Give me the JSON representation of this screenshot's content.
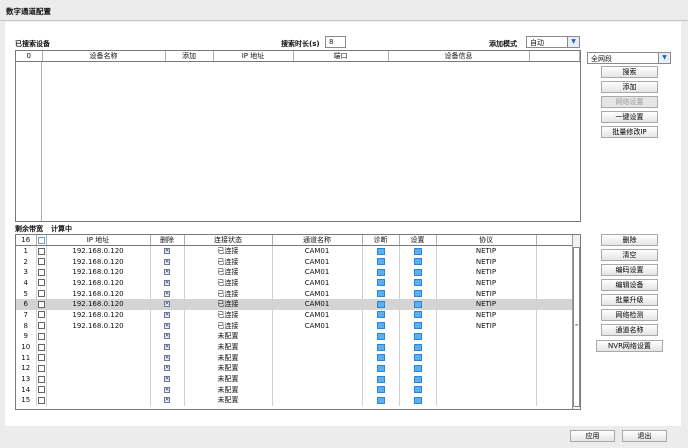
{
  "window": {
    "title": "数字通道配置"
  },
  "search": {
    "found_label": "已搜索设备",
    "duration_label": "搜索时长(s)",
    "duration_value": "8",
    "add_mode_label": "添加模式",
    "add_mode_value": "自动",
    "network_select": "全网段"
  },
  "top_table": {
    "headers": [
      "0",
      "设备名称",
      "添加",
      "IP 地址",
      "端口",
      "设备信息"
    ]
  },
  "top_buttons": {
    "search": "搜索",
    "add": "添加",
    "network_settings": "网络设置",
    "one_click_settings": "一键设置",
    "batch_modify_ip": "批量修改IP"
  },
  "bandwidth": {
    "label": "剩余带宽",
    "value": "计算中"
  },
  "bottom_table": {
    "headers": [
      "16",
      "IP 地址",
      "删除",
      "连接状态",
      "通道名称",
      "诊断",
      "设置",
      "协议"
    ],
    "rows": [
      {
        "num": "1",
        "ip": "192.168.0.120",
        "status": "已连接",
        "channel": "CAM01",
        "protocol": "NETIP"
      },
      {
        "num": "2",
        "ip": "192.168.0.120",
        "status": "已连接",
        "channel": "CAM01",
        "protocol": "NETIP"
      },
      {
        "num": "3",
        "ip": "192.168.0.120",
        "status": "已连接",
        "channel": "CAM01",
        "protocol": "NETIP"
      },
      {
        "num": "4",
        "ip": "192.168.0.120",
        "status": "已连接",
        "channel": "CAM01",
        "protocol": "NETIP"
      },
      {
        "num": "5",
        "ip": "192.168.0.120",
        "status": "已连接",
        "channel": "CAM01",
        "protocol": "NETIP"
      },
      {
        "num": "6",
        "ip": "192.168.0.120",
        "status": "已连接",
        "channel": "CAM01",
        "protocol": "NETIP"
      },
      {
        "num": "7",
        "ip": "192.168.0.120",
        "status": "已连接",
        "channel": "CAM01",
        "protocol": "NETIP"
      },
      {
        "num": "8",
        "ip": "192.168.0.120",
        "status": "已连接",
        "channel": "CAM01",
        "protocol": "NETIP"
      },
      {
        "num": "9",
        "ip": "",
        "status": "未配置",
        "channel": "",
        "protocol": ""
      },
      {
        "num": "10",
        "ip": "",
        "status": "未配置",
        "channel": "",
        "protocol": ""
      },
      {
        "num": "11",
        "ip": "",
        "status": "未配置",
        "channel": "",
        "protocol": ""
      },
      {
        "num": "12",
        "ip": "",
        "status": "未配置",
        "channel": "",
        "protocol": ""
      },
      {
        "num": "13",
        "ip": "",
        "status": "未配置",
        "channel": "",
        "protocol": ""
      },
      {
        "num": "14",
        "ip": "",
        "status": "未配置",
        "channel": "",
        "protocol": ""
      },
      {
        "num": "15",
        "ip": "",
        "status": "未配置",
        "channel": "",
        "protocol": ""
      }
    ],
    "selected_row": 5
  },
  "side_buttons": {
    "delete": "删除",
    "clear": "清空",
    "encode_settings": "编码设置",
    "edit_device": "编辑设备",
    "batch_upgrade": "批量升级",
    "network_detect": "网络检测",
    "channel_name": "通道名称",
    "nvr_network_settings": "NVR网络设置"
  },
  "footer": {
    "apply": "应用",
    "exit": "退出"
  }
}
